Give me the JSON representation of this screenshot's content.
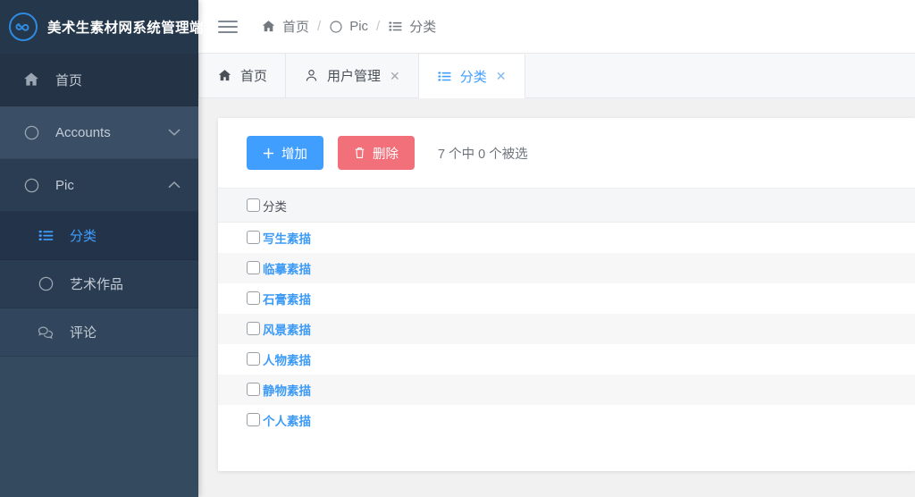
{
  "brand": {
    "title": "美术生素材网系统管理端",
    "logo_icon": "infinity-circle-icon"
  },
  "sidebar": {
    "items": [
      {
        "label": "首页",
        "icon": "home-icon",
        "caret": ""
      },
      {
        "label": "Accounts",
        "icon": "circle-icon",
        "caret": "⌄"
      },
      {
        "label": "Pic",
        "icon": "circle-icon",
        "caret": "⌃"
      }
    ],
    "subitems": [
      {
        "label": "分类",
        "icon": "list-icon",
        "active": true
      },
      {
        "label": "艺术作品",
        "icon": "circle-icon",
        "active": false
      },
      {
        "label": "评论",
        "icon": "comments-icon",
        "active": false
      }
    ]
  },
  "topbar": {
    "menu_icon": "hamburger-icon",
    "breadcrumb": [
      {
        "label": "首页",
        "icon": "home-icon"
      },
      {
        "label": "Pic",
        "icon": "circle-icon"
      },
      {
        "label": "分类",
        "icon": "list-icon"
      }
    ],
    "separator": "/"
  },
  "tabs": [
    {
      "label": "首页",
      "icon": "home-icon",
      "closable": false,
      "active": false
    },
    {
      "label": "用户管理",
      "icon": "user-icon",
      "closable": true,
      "active": false
    },
    {
      "label": "分类",
      "icon": "list-icon",
      "closable": true,
      "active": true
    }
  ],
  "toolbar": {
    "add_label": "增加",
    "add_icon": "plus-icon",
    "delete_label": "删除",
    "delete_icon": "trash-icon",
    "selection_info": "7 个中 0 个被选"
  },
  "table": {
    "columns": [
      "分类"
    ],
    "rows": [
      {
        "name": "写生素描",
        "checked": false
      },
      {
        "name": "临摹素描",
        "checked": false
      },
      {
        "name": "石膏素描",
        "checked": false
      },
      {
        "name": "风景素描",
        "checked": false
      },
      {
        "name": "人物素描",
        "checked": false
      },
      {
        "name": "静物素描",
        "checked": false
      },
      {
        "name": "个人素描",
        "checked": false
      }
    ]
  },
  "colors": {
    "accent": "#409eff",
    "danger": "#f2707a",
    "sidebar_bg": "#344a5f",
    "brand_bg": "#25374a",
    "link": "#3d9bf5"
  }
}
